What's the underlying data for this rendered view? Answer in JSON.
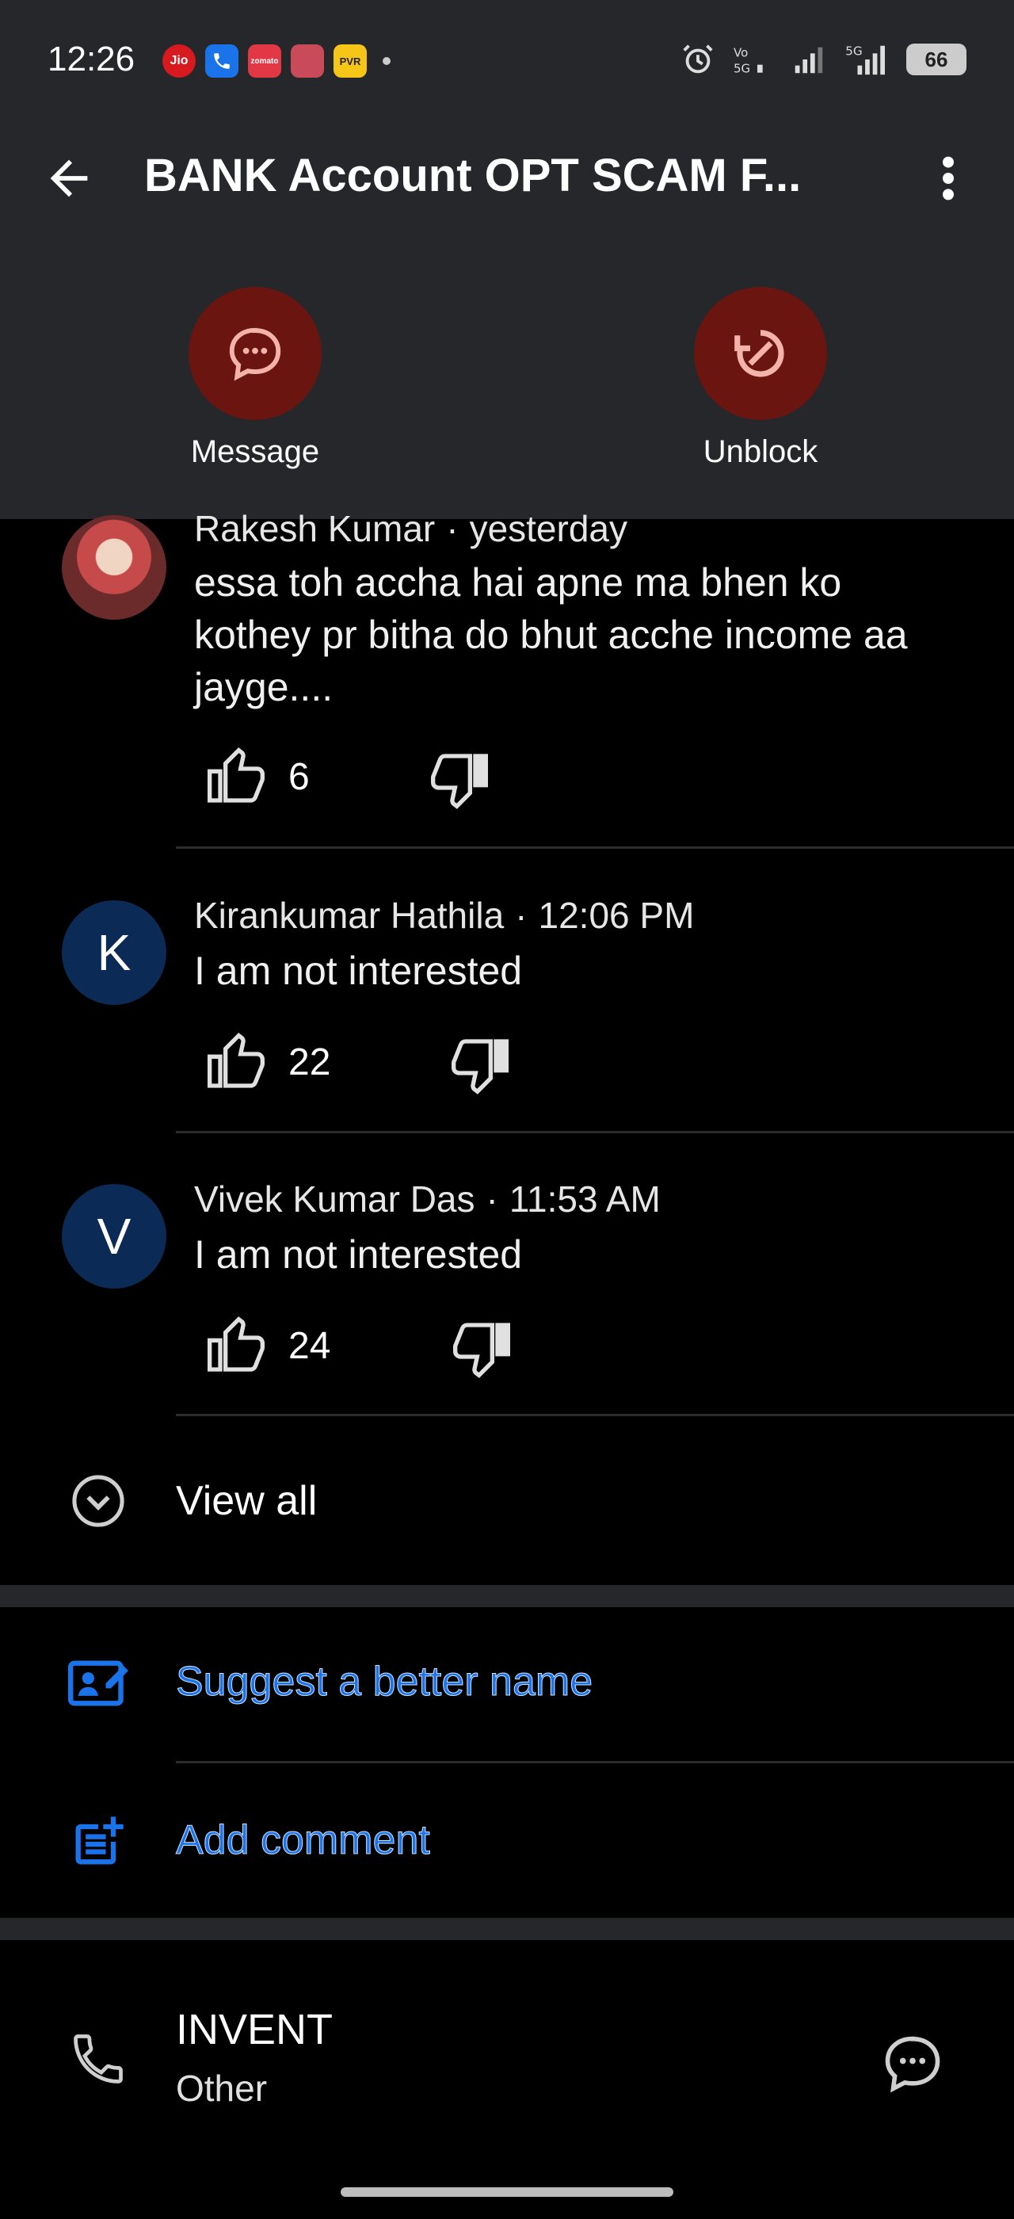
{
  "status": {
    "time": "12:26",
    "notifications": [
      "Jio",
      "phone",
      "zomato",
      "app",
      "PVR"
    ],
    "battery": "66"
  },
  "header": {
    "title": "BANK Account OPT SCAM F..."
  },
  "actions": {
    "message_label": "Message",
    "unblock_label": "Unblock",
    "accent_color": "#6a1510"
  },
  "comments": [
    {
      "author": "Rakesh Kumar",
      "time": "yesterday",
      "text": "essa toh accha hai apne ma bhen ko kothey pr bitha do bhut acche income aa jayge....",
      "likes": "6",
      "avatar_letter": ""
    },
    {
      "author": "Kirankumar Hathila",
      "time": "12:06 PM",
      "text": "I am not interested",
      "likes": "22",
      "avatar_letter": "K"
    },
    {
      "author": "Vivek Kumar Das",
      "time": "11:53 AM",
      "text": "I am not interested",
      "likes": "24",
      "avatar_letter": "V"
    }
  ],
  "view_all_label": "View all",
  "links": {
    "suggest_label": "Suggest a better name",
    "add_comment_label": "Add comment",
    "link_color": "#1a73e8"
  },
  "contact": {
    "name": "INVENT",
    "type": "Other"
  }
}
